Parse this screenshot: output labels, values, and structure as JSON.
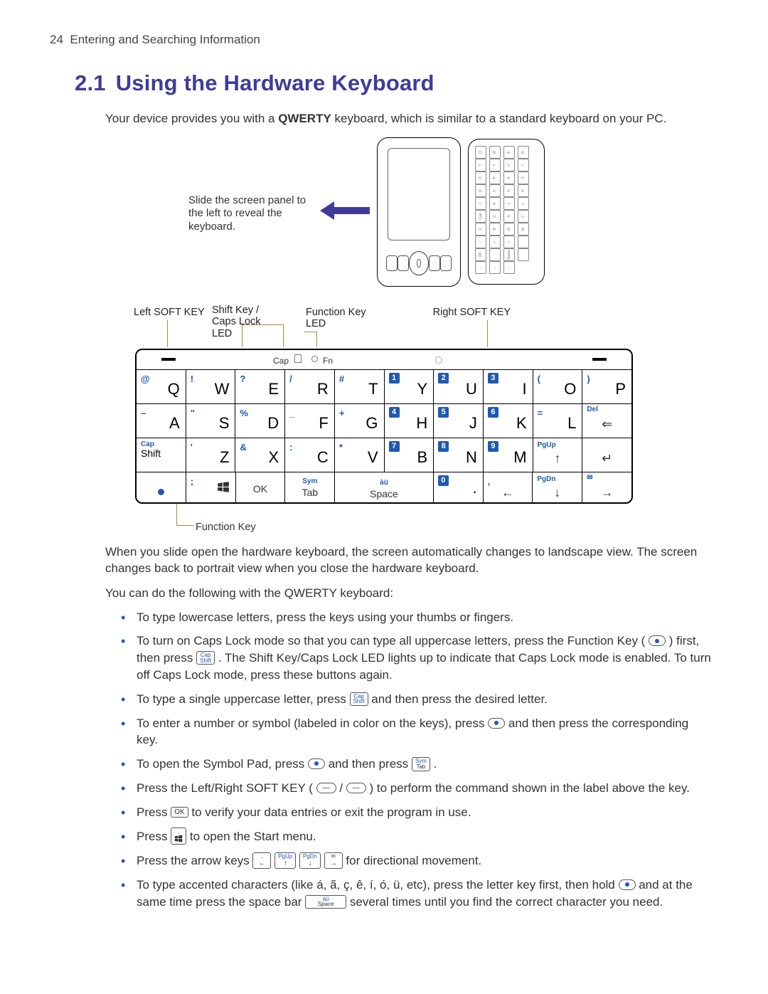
{
  "header": {
    "page_number": "24",
    "chapter": "Entering and Searching Information"
  },
  "section": {
    "number": "2.1",
    "title": "Using the Hardware Keyboard"
  },
  "intro": {
    "pre": "Your device provides you with a ",
    "bold": "QWERTY",
    "post": " keyboard, which is similar to a standard keyboard on your PC."
  },
  "figure1": {
    "caption": "Slide the screen panel to the left to reveal the keyboard."
  },
  "labels": {
    "left_soft": "Left SOFT KEY",
    "shift_caps": "Shift Key / Caps Lock LED",
    "fn_led": "Function Key LED",
    "right_soft": "Right SOFT KEY",
    "fn_key": "Function Key",
    "cap": "Cap",
    "fn": "Fn"
  },
  "keys": {
    "r1": [
      {
        "sec": "@",
        "main": "Q"
      },
      {
        "sec": "!",
        "main": "W"
      },
      {
        "sec": "?",
        "main": "E"
      },
      {
        "sec": "/",
        "main": "R"
      },
      {
        "sec": "#",
        "main": "T"
      },
      {
        "num": "1",
        "main": "Y"
      },
      {
        "num": "2",
        "main": "U"
      },
      {
        "num": "3",
        "main": "I"
      },
      {
        "sec": "(",
        "main": "O"
      },
      {
        "sec": ")",
        "main": "P"
      }
    ],
    "r2": [
      {
        "sec": "–",
        "main": "A"
      },
      {
        "sec": "\"",
        "main": "S"
      },
      {
        "sec": "%",
        "main": "D"
      },
      {
        "sec": "_",
        "main": "F"
      },
      {
        "sec": "+",
        "main": "G"
      },
      {
        "num": "4",
        "main": "H"
      },
      {
        "num": "5",
        "main": "J"
      },
      {
        "num": "6",
        "main": "K"
      },
      {
        "sec": "=",
        "main": "L"
      },
      {
        "del": "Del",
        "main": "⇐"
      }
    ],
    "r3": [
      {
        "twoline": "Cap|Shift"
      },
      {
        "sec": "'",
        "main": "Z"
      },
      {
        "sec": "&",
        "main": "X"
      },
      {
        "sec": ":",
        "main": "C"
      },
      {
        "sec": "*",
        "main": "V"
      },
      {
        "num": "7",
        "main": "B"
      },
      {
        "num": "8",
        "main": "N"
      },
      {
        "num": "9",
        "main": "M"
      },
      {
        "pg": "PgUp",
        "main": "↑"
      },
      {
        "main": "↵"
      }
    ],
    "r4": [
      {
        "fndot": true
      },
      {
        "sec": ";",
        "win": true
      },
      {
        "main": "OK"
      },
      {
        "twolbl": "Sym|Tab"
      },
      {
        "space": true,
        "sec": "àü",
        "main": "Space"
      },
      {
        "num": "0",
        "main": "."
      },
      {
        "sec": ",",
        "main": "←"
      },
      {
        "pg": "PgDn",
        "main": "↓"
      },
      {
        "send": true,
        "main": "→"
      }
    ]
  },
  "body": {
    "p1": "When you slide open the hardware keyboard, the screen automatically changes to landscape view. The screen changes back to portrait view when you close the hardware keyboard.",
    "p2": "You can do the following with the QWERTY keyboard:",
    "b1": "To type lowercase letters, press the keys using your thumbs or fingers.",
    "b2a": "To turn on Caps Lock mode so that you can type all uppercase letters, press the Function Key ( ",
    "b2b": " ) first, then press ",
    "b2c": " . The Shift Key/Caps Lock LED lights up to indicate that Caps Lock mode is enabled. To turn off Caps Lock mode, press these buttons again.",
    "b3a": "To type a single uppercase letter, press ",
    "b3b": " and then press the desired letter.",
    "b4a": "To enter a number or symbol (labeled in color on the keys), press ",
    "b4b": " and then press the corresponding key.",
    "b5a": "To open the Symbol Pad, press ",
    "b5b": " and then press ",
    "b5c": " .",
    "b6a": "Press the Left/Right SOFT KEY ( ",
    "b6b": " / ",
    "b6c": " ) to perform the command shown in the label above the key.",
    "b7a": "Press ",
    "b7b": " to verify your data entries or exit the program in use.",
    "b8a": "Press ",
    "b8b": " to open the Start menu.",
    "b9a": "Press the arrow keys ",
    "b9b": " for directional movement.",
    "b10a": "To type accented characters (like á, ã, ç, ê, í, ó, ü, etc), press the letter key first, then hold ",
    "b10b": " and at the same time press the space bar ",
    "b10c": " several times until you find the correct character you need."
  },
  "icons": {
    "cap": "Cap",
    "shift": "Shift",
    "ok": "OK",
    "sym": "Sym",
    "tab": "Tab",
    "pgup": "PgUp",
    "pgdn": "PgDn",
    "space": "Space",
    "au": "àü"
  }
}
